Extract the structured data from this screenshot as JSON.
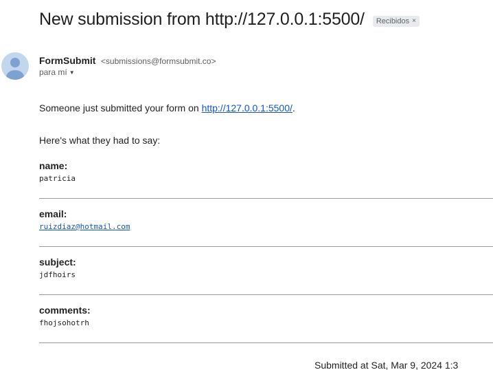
{
  "email": {
    "subject": "New submission from http://127.0.0.1:5500/",
    "label_chip": "Recibidos",
    "label_chip_close": "×",
    "sender_name": "FormSubmit",
    "sender_email": "<submissions@formsubmit.co>",
    "recipient": "para mí",
    "avatar_icon": "person-icon"
  },
  "body": {
    "intro_text": "Someone just submitted your form on",
    "intro_link": "http://127.0.0.1:5500/",
    "intro_suffix": ".",
    "said_text": "Here's what they had to say:",
    "fields": [
      {
        "label": "name:",
        "value": "patricia"
      },
      {
        "label": "email:",
        "value": "ruizdiaz@hotmail.com"
      },
      {
        "label": "subject:",
        "value": "jdfhoirs"
      },
      {
        "label": "comments:",
        "value": "fhojsohotrh"
      }
    ],
    "footer": "Submitted at Sat, Mar 9, 2024 1:3"
  },
  "colors": {
    "link": "#1155cc",
    "avatar_bg": "#c2d6ee",
    "avatar_fg": "#7da1d1",
    "chip_bg": "#e8eaed"
  }
}
